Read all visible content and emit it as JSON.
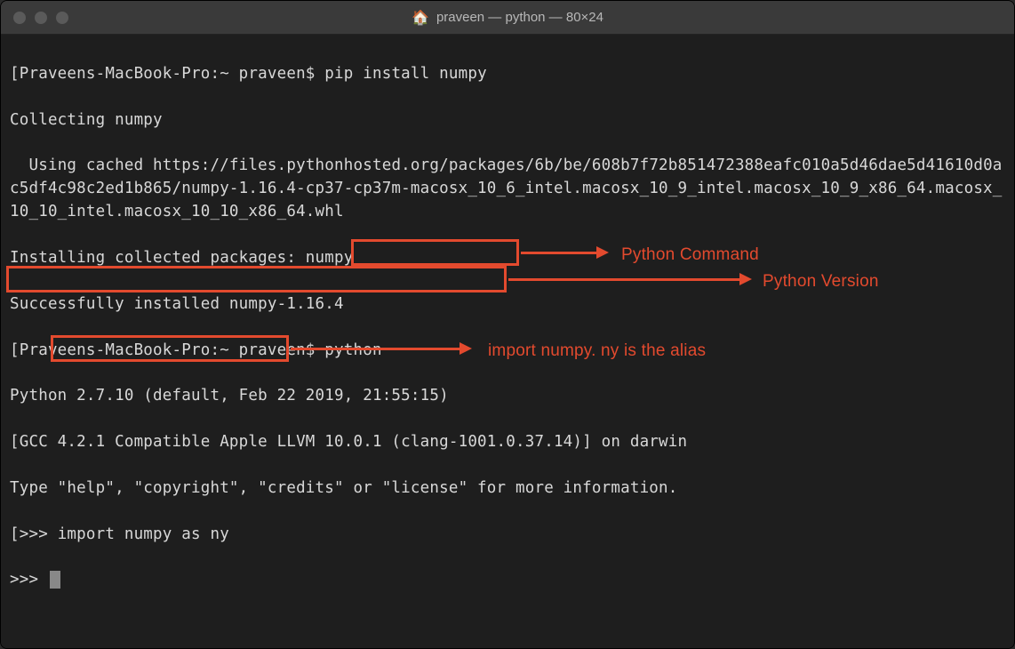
{
  "window": {
    "title": "praveen — python — 80×24"
  },
  "terminal": {
    "line1_prompt": "[Praveens-MacBook-Pro:~ praveen$ ",
    "line1_cmd": "pip install numpy",
    "line1_end": "]",
    "line2": "Collecting numpy",
    "line3": "  Using cached https://files.pythonhosted.org/packages/6b/be/608b7f72b851472388eafc010a5d46dae5d41610d0ac5df4c98c2ed1b865/numpy-1.16.4-cp37-cp37m-macosx_10_6_intel.macosx_10_9_intel.macosx_10_9_x86_64.macosx_10_10_intel.macosx_10_10_x86_64.whl",
    "line4": "Installing collected packages: numpy",
    "line5": "Successfully installed numpy-1.16.4",
    "line6_prompt": "[Praveens-MacBook-Pro:~ praveen$ ",
    "line6_cmd": "python",
    "line6_end": "]",
    "line7": "Python 2.7.10 (default, Feb 22 2019, 21:55:15)",
    "line8": "[GCC 4.2.1 Compatible Apple LLVM 10.0.1 (clang-1001.0.37.14)] on darwin",
    "line9": "Type \"help\", \"copyright\", \"credits\" or \"license\" for more information.",
    "line10_prompt": "[>>> ",
    "line10_cmd": "import numpy as ny",
    "line10_end": "]",
    "line11": ">>> "
  },
  "annotations": {
    "label1": "Python Command",
    "label2": "Python Version",
    "label3": "import numpy. ny is the alias"
  }
}
